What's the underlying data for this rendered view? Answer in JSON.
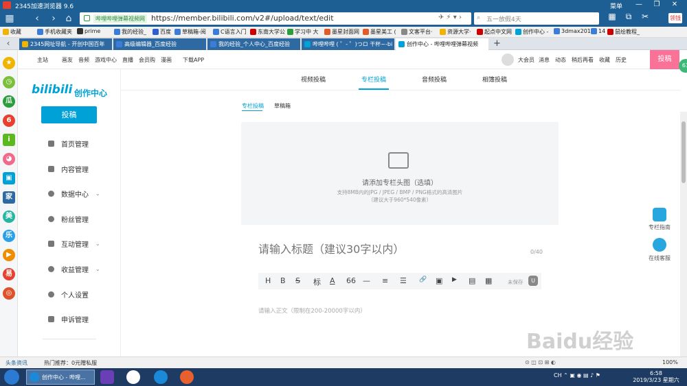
{
  "browser": {
    "title": "2345加速浏览器 9.6",
    "menu_label": "菜单",
    "address": {
      "site_badge": "哔哩哔哩弹幕视频网",
      "url": "https://member.bilibili.com/v2#/upload/text/edit"
    },
    "search_placeholder": "五一放假4天",
    "vip_badge": "领钱"
  },
  "bookmarks": [
    "收藏",
    "手机收藏夹",
    "prime",
    "我的经验_",
    "百度",
    "草稿箱-阅",
    "C语言入门",
    "东南大学公",
    "学习中 大",
    "墨星封面网",
    "墨星美工 (",
    "文客平台·",
    "资源大学·",
    "起点中文网",
    "创作中心 -",
    "3dmax201",
    "14",
    "鼠绘教程_"
  ],
  "tabs": [
    {
      "label": "2345网址导航 - 开创中国百年",
      "active": false
    },
    {
      "label": "高级编辑器_百度经验",
      "active": false
    },
    {
      "label": "我的经验_个人中心_百度经验",
      "active": false
    },
    {
      "label": "哔哩哔哩 ( ゜- ゜)つロ 干杯~-bi",
      "active": false
    },
    {
      "label": "创作中心 - 哔哩哔哩弹幕视频",
      "active": true
    }
  ],
  "topnav": {
    "left": [
      "主站",
      "画友",
      "音频",
      "游戏中心",
      "直播",
      "会员购",
      "漫画",
      "下载APP"
    ],
    "right": [
      "大会员",
      "消息",
      "动态",
      "稍后再看",
      "收藏",
      "历史"
    ],
    "post_button": "投稿"
  },
  "sidebar": {
    "logo": "bilibili",
    "logo_sub": "创作中心",
    "upload_button": "投稿",
    "items": [
      {
        "label": "首页管理",
        "has_children": false
      },
      {
        "label": "内容管理",
        "has_children": false
      },
      {
        "label": "数据中心",
        "has_children": true
      },
      {
        "label": "粉丝管理",
        "has_children": false
      },
      {
        "label": "互动管理",
        "has_children": true
      },
      {
        "label": "收益管理",
        "has_children": true
      },
      {
        "label": "个人设置",
        "has_children": false
      },
      {
        "label": "申诉管理",
        "has_children": false
      }
    ]
  },
  "main": {
    "tabs": [
      "视频投稿",
      "专栏投稿",
      "音频投稿",
      "相簿投稿"
    ],
    "active_tab": "专栏投稿",
    "subtabs": [
      "专栏投稿",
      "草稿箱"
    ],
    "cover": {
      "title": "请添加专栏头图（选填）",
      "hint1": "支持8MB内的JPG / JPEG / BMP / PNG格式的高清图片",
      "hint2": "（建议大于960*540像素）"
    },
    "title_placeholder": "请输入标题（建议30字以内）",
    "title_count": "0/40",
    "toolbar": [
      "H",
      "B",
      "S",
      "标",
      "A",
      "66",
      "—",
      "≡",
      "☰",
      "🔗",
      "▣",
      "▶",
      "▤",
      "▦"
    ],
    "autosave": "未保存",
    "body_placeholder": "请输入正文（限制在200-20000字以内）"
  },
  "float": {
    "help": "专栏指南",
    "service": "在线客服"
  },
  "statusbar": {
    "news": "头条资讯",
    "hot": "热门推荐：0元赠私服",
    "zoom": "100%"
  },
  "taskbar": {
    "active_task": "创作中心 - 哔哩...",
    "time": "6:58",
    "date": "2019/3/23 星期六",
    "tray": "CH"
  },
  "watermark": "Baidu经验"
}
